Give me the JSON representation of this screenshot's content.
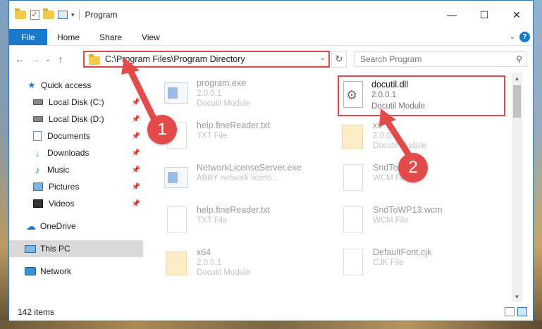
{
  "window": {
    "title": "Program",
    "controls": {
      "minimize": "—",
      "maximize": "☐",
      "close": "✕"
    }
  },
  "ribbon": {
    "tabs": [
      "File",
      "Home",
      "Share",
      "View"
    ],
    "help": "?"
  },
  "address": {
    "path": "C:\\Program Files\\Program Directory",
    "search_placeholder": "Search Program"
  },
  "sidebar": {
    "items": [
      {
        "label": "Quick access",
        "icon": "star-icon"
      },
      {
        "label": "Local Disk (C:)",
        "icon": "disk-icon",
        "pinned": true
      },
      {
        "label": "Local Disk (D:)",
        "icon": "disk-icon",
        "pinned": true
      },
      {
        "label": "Documents",
        "icon": "documents-icon",
        "pinned": true
      },
      {
        "label": "Downloads",
        "icon": "download-icon",
        "pinned": true
      },
      {
        "label": "Music",
        "icon": "music-icon",
        "pinned": true
      },
      {
        "label": "Pictures",
        "icon": "pictures-icon",
        "pinned": true
      },
      {
        "label": "Videos",
        "icon": "videos-icon",
        "pinned": true
      },
      {
        "label": "OneDrive",
        "icon": "cloud-icon"
      },
      {
        "label": "This PC",
        "icon": "computer-icon",
        "selected": true
      },
      {
        "label": "Network",
        "icon": "network-icon"
      }
    ]
  },
  "files": [
    {
      "name": "program.exe",
      "line2": "2.0.0.1",
      "line3": "Docutil Module",
      "icon": "exe-icon"
    },
    {
      "name": "docutil.dll",
      "line2": "2.0.0.1",
      "line3": "Docutil Module",
      "icon": "dll-gear-icon"
    },
    {
      "name": "help.fineReader.txt",
      "line2": "TXT File",
      "line3": "",
      "icon": "text-file-icon"
    },
    {
      "name": "x6",
      "line2": "2.0.0.1",
      "line3": "Docutil Module",
      "icon": "folder-file-icon"
    },
    {
      "name": "NetworkLicenseServer.exe",
      "line2": "ABBY network licens...",
      "line3": "",
      "icon": "exe-icon"
    },
    {
      "name": "SndTo...wcm",
      "line2": "WCM File",
      "line3": "",
      "icon": "text-file-icon"
    },
    {
      "name": "help.fineReader.txt",
      "line2": "TXT File",
      "line3": "",
      "icon": "text-file-icon"
    },
    {
      "name": "SndToWP13.wcm",
      "line2": "WCM File",
      "line3": "",
      "icon": "text-file-icon"
    },
    {
      "name": "x64",
      "line2": "2.0.0.1",
      "line3": "Docutil Module",
      "icon": "folder-file-icon"
    },
    {
      "name": "DefaultFont.cjk",
      "line2": "CJK File",
      "line3": "",
      "icon": "text-file-icon"
    }
  ],
  "status": {
    "items_count": "142 items"
  },
  "callouts": {
    "one": "1",
    "two": "2"
  },
  "colors": {
    "accent": "#1979ca",
    "highlight": "#e04848"
  }
}
